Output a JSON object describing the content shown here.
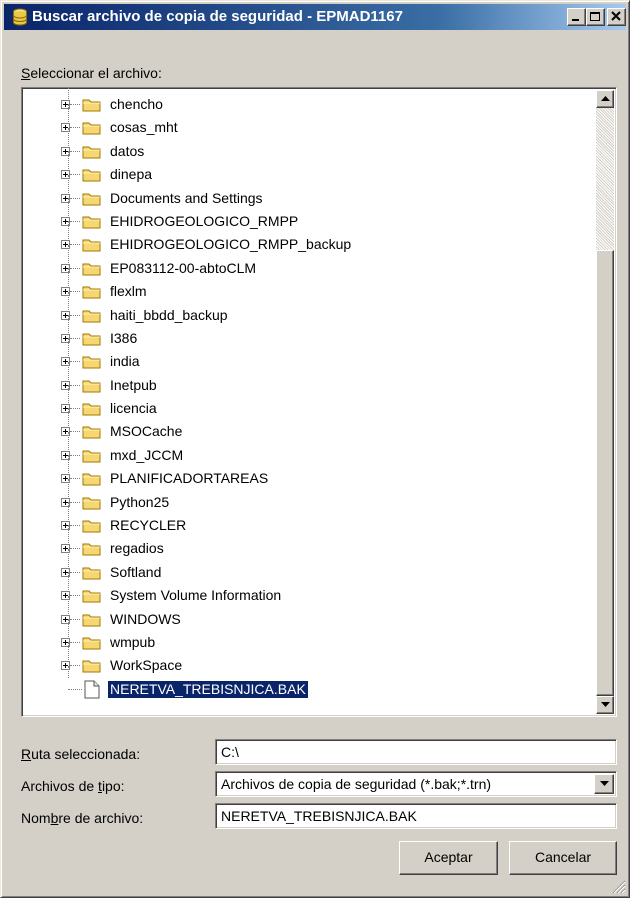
{
  "window": {
    "title": "Buscar archivo de copia de seguridad - EPMAD1167",
    "icon": "database-icon",
    "controls": [
      "minimize-icon",
      "maximize-icon",
      "close-icon"
    ]
  },
  "tree": {
    "label_accesskey": "S",
    "label_rest": "eleccionar el archivo:",
    "folders": [
      "chencho",
      "cosas_mht",
      "datos",
      "dinepa",
      "Documents and Settings",
      "EHIDROGEOLOGICO_RMPP",
      "EHIDROGEOLOGICO_RMPP_backup",
      "EP083112-00-abtoCLM",
      "flexlm",
      "haiti_bbdd_backup",
      "I386",
      "india",
      "Inetpub",
      "licencia",
      "MSOCache",
      "mxd_JCCM",
      "PLANIFICADORTAREAS",
      "Python25",
      "RECYCLER",
      "regadios",
      "Softland",
      "System Volume Information",
      "WINDOWS",
      "wmpub",
      "WorkSpace"
    ],
    "selected_file": "NERETVA_TREBISNJICA.BAK"
  },
  "form": {
    "ruta": {
      "accesskey": "R",
      "rest": "uta seleccionada:",
      "value": "C:\\"
    },
    "tipo": {
      "before": "Archivos de ",
      "accesskey": "t",
      "after": "ipo:",
      "value": "Archivos de copia de seguridad (*.bak;*.trn)"
    },
    "nombre": {
      "before": "Nom",
      "accesskey": "b",
      "after": "re de archivo:",
      "value": "NERETVA_TREBISNJICA.BAK"
    }
  },
  "buttons": {
    "ok": "Aceptar",
    "cancel": "Cancelar"
  },
  "colors": {
    "title_start": "#0a246a",
    "title_end": "#a6caf0",
    "selection": "#0a246a",
    "face": "#d4d0c8",
    "folder": "#f7d774"
  }
}
